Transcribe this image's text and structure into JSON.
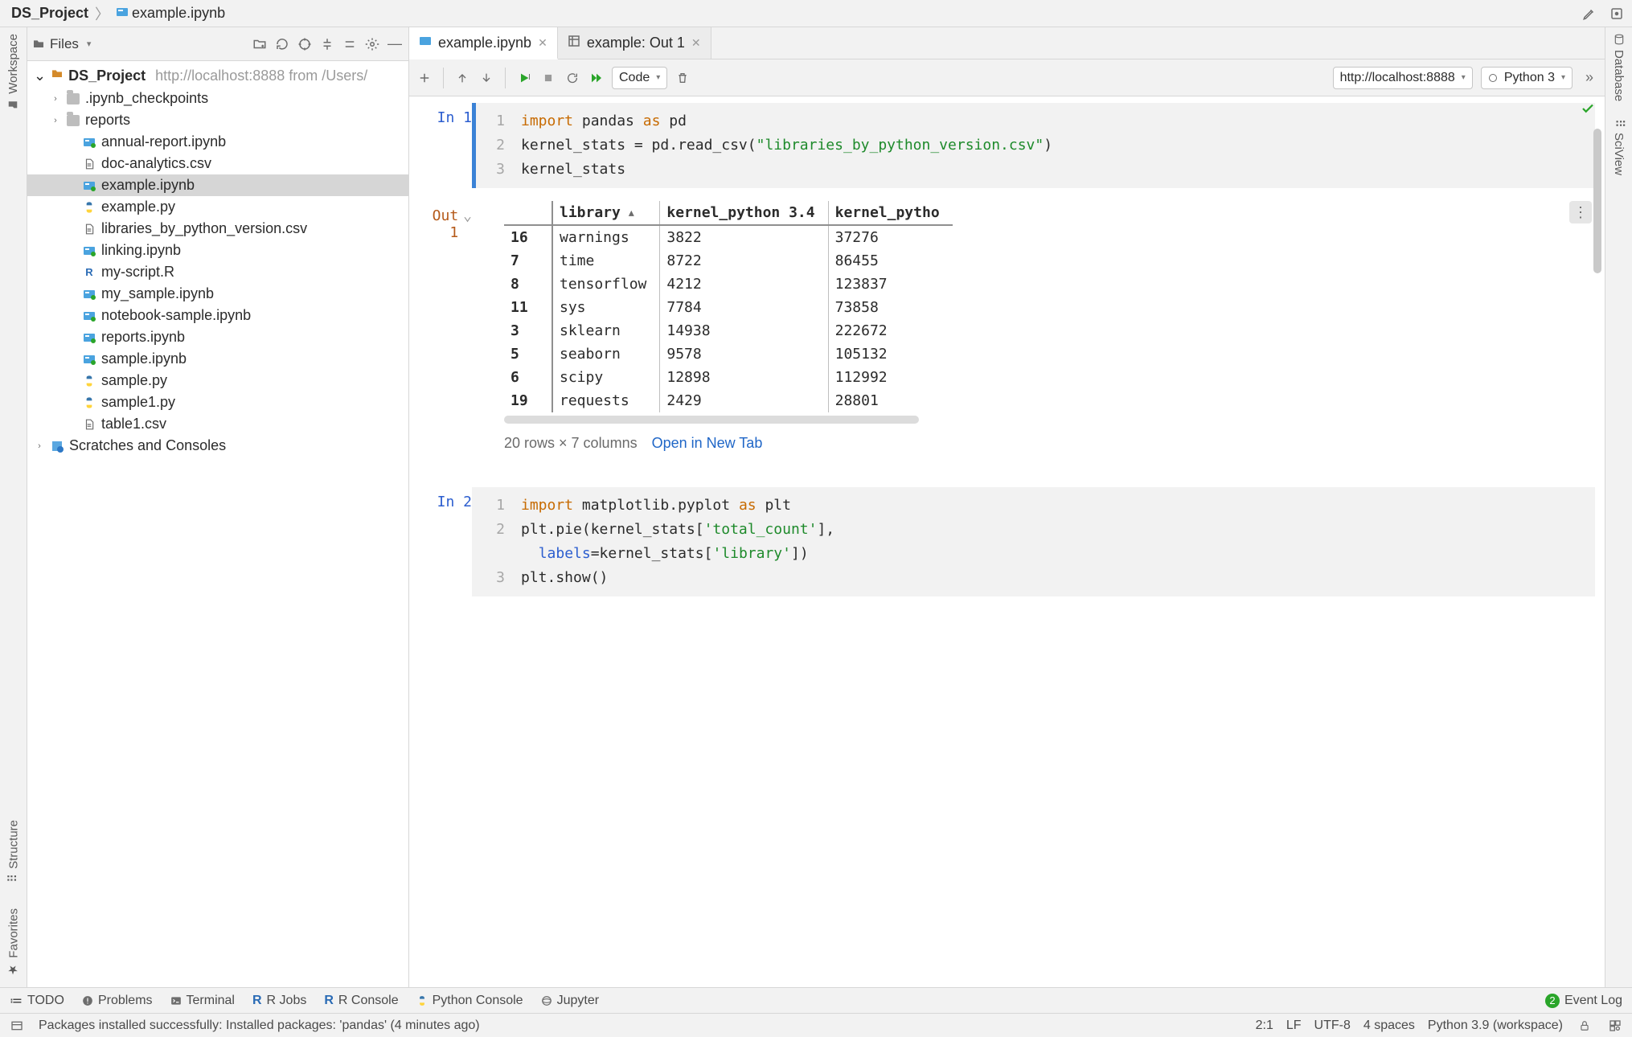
{
  "breadcrumbs": {
    "root": "DS_Project",
    "file": "example.ipynb"
  },
  "topbar_icons": {
    "edit": "edit-icon",
    "emu": "emulator-icon"
  },
  "left_rail": {
    "workspace": "Workspace",
    "structure": "Structure",
    "favorites": "Favorites"
  },
  "right_rail": {
    "database": "Database",
    "sciview": "SciView"
  },
  "project_panel": {
    "title": "Files",
    "root_name": "DS_Project",
    "root_hint": "http://localhost:8888 from /Users/",
    "scratches": "Scratches and Consoles",
    "items": [
      {
        "name": ".ipynb_checkpoints",
        "type": "folder",
        "depth": 1,
        "arrow": "›"
      },
      {
        "name": "reports",
        "type": "folder",
        "depth": 1,
        "arrow": "›"
      },
      {
        "name": "annual-report.ipynb",
        "type": "nb",
        "depth": 2
      },
      {
        "name": "doc-analytics.csv",
        "type": "csv",
        "depth": 2
      },
      {
        "name": "example.ipynb",
        "type": "nb",
        "depth": 2,
        "selected": true
      },
      {
        "name": "example.py",
        "type": "py",
        "depth": 2
      },
      {
        "name": "libraries_by_python_version.csv",
        "type": "csv",
        "depth": 2
      },
      {
        "name": "linking.ipynb",
        "type": "nb",
        "depth": 2
      },
      {
        "name": "my-script.R",
        "type": "r",
        "depth": 2
      },
      {
        "name": "my_sample.ipynb",
        "type": "nb",
        "depth": 2
      },
      {
        "name": "notebook-sample.ipynb",
        "type": "nb",
        "depth": 2
      },
      {
        "name": "reports.ipynb",
        "type": "nb",
        "depth": 2
      },
      {
        "name": "sample.ipynb",
        "type": "nb",
        "depth": 2
      },
      {
        "name": "sample.py",
        "type": "py",
        "depth": 2
      },
      {
        "name": "sample1.py",
        "type": "py",
        "depth": 2
      },
      {
        "name": "table1.csv",
        "type": "csv",
        "depth": 2
      }
    ]
  },
  "tabs": [
    {
      "label": "example.ipynb",
      "type": "nb",
      "active": true
    },
    {
      "label": "example: Out 1",
      "type": "table",
      "active": false
    }
  ],
  "nb_toolbar": {
    "celltype": "Code",
    "server": "http://localhost:8888",
    "kernel": "Python 3"
  },
  "cells": {
    "in1_label": "In 1",
    "in1_lines": [
      {
        "ln": "1",
        "html": "<span class='tok-kw'>import</span> pandas <span class='tok-as'>as</span> pd"
      },
      {
        "ln": "2",
        "html": "kernel_stats = pd.read_csv(<span class='tok-str'>\"libraries_by_python_version.csv\"</span>)"
      },
      {
        "ln": "3",
        "html": "kernel_stats"
      }
    ],
    "out1_label": "Out 1",
    "in2_label": "In 2",
    "in2_lines": [
      {
        "ln": "1",
        "html": "<span class='tok-kw'>import</span> matplotlib.pyplot <span class='tok-as'>as</span> plt"
      },
      {
        "ln": "2",
        "html": "plt.pie(kernel_stats[<span class='tok-str'>'total_count'</span>],"
      },
      {
        "ln": " ",
        "html": "  <span class='tok-blue'>labels</span>=kernel_stats[<span class='tok-str'>'library'</span>])"
      },
      {
        "ln": "3",
        "html": "plt.show()"
      }
    ]
  },
  "out_table": {
    "headers": [
      "",
      "library",
      "kernel_python 3.4",
      "kernel_pytho"
    ],
    "sort_col": 1,
    "rows": [
      [
        "16",
        "warnings",
        "3822",
        "37276"
      ],
      [
        "7",
        "time",
        "8722",
        "86455"
      ],
      [
        "8",
        "tensorflow",
        "4212",
        "123837"
      ],
      [
        "11",
        "sys",
        "7784",
        "73858"
      ],
      [
        "3",
        "sklearn",
        "14938",
        "222672"
      ],
      [
        "5",
        "seaborn",
        "9578",
        "105132"
      ],
      [
        "6",
        "scipy",
        "12898",
        "112992"
      ],
      [
        "19",
        "requests",
        "2429",
        "28801"
      ]
    ],
    "footer_shape": "20 rows × 7 columns",
    "footer_link": "Open in New Tab"
  },
  "bottom_tools": {
    "todo": "TODO",
    "problems": "Problems",
    "terminal": "Terminal",
    "rjobs": "R Jobs",
    "rconsole": "R Console",
    "pyconsole": "Python Console",
    "jupyter": "Jupyter",
    "event_log": "Event Log",
    "event_count": "2"
  },
  "statusbar": {
    "msg": "Packages installed successfully: Installed packages: 'pandas' (4 minutes ago)",
    "pos": "2:1",
    "sep": "LF",
    "enc": "UTF-8",
    "indent": "4 spaces",
    "interp": "Python 3.9 (workspace)"
  }
}
